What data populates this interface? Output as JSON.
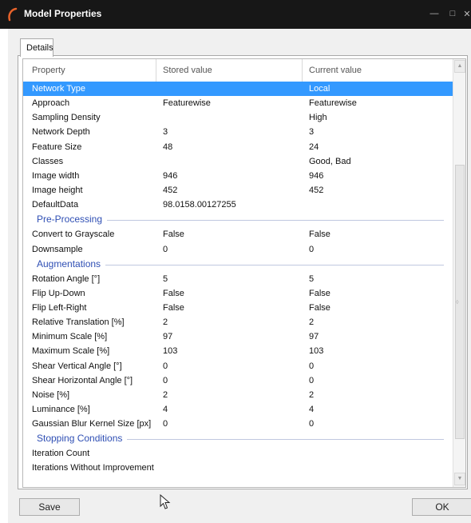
{
  "window": {
    "title": "Model Properties",
    "logo_icon": "app-logo-icon",
    "accent": "#e8632b",
    "title_bar_color": "#171717"
  },
  "tabs": [
    {
      "label": "Details"
    }
  ],
  "grid": {
    "columns": [
      "Property",
      "Stored value",
      "Current value"
    ],
    "selected_color": "#3399ff",
    "top_rows": [
      {
        "name": "Network Type",
        "stored": "",
        "current": "Local",
        "selected": true
      },
      {
        "name": "Approach",
        "stored": "Featurewise",
        "current": "Featurewise"
      },
      {
        "name": "Sampling Density",
        "stored": "",
        "current": "High"
      },
      {
        "name": "Network Depth",
        "stored": "3",
        "current": "3"
      },
      {
        "name": "Feature Size",
        "stored": "48",
        "current": "24"
      },
      {
        "name": "Classes",
        "stored": "",
        "current": "Good, Bad"
      },
      {
        "name": "Image width",
        "stored": "946",
        "current": "946"
      },
      {
        "name": "Image height",
        "stored": "452",
        "current": "452"
      },
      {
        "name": "DefaultData",
        "stored": "98.0158.00127255",
        "current": ""
      }
    ],
    "categories": [
      {
        "title": "Pre-Processing",
        "rows": [
          {
            "name": "Convert to Grayscale",
            "stored": "False",
            "current": "False"
          },
          {
            "name": "Downsample",
            "stored": "0",
            "current": "0"
          }
        ]
      },
      {
        "title": "Augmentations",
        "rows": [
          {
            "name": "Rotation Angle [°]",
            "stored": "5",
            "current": "5"
          },
          {
            "name": "Flip Up-Down",
            "stored": "False",
            "current": "False"
          },
          {
            "name": "Flip Left-Right",
            "stored": "False",
            "current": "False"
          },
          {
            "name": "Relative Translation [%]",
            "stored": "2",
            "current": "2"
          },
          {
            "name": "Minimum Scale [%]",
            "stored": "97",
            "current": "97"
          },
          {
            "name": "Maximum Scale [%]",
            "stored": "103",
            "current": "103"
          },
          {
            "name": "Shear Vertical Angle [°]",
            "stored": "0",
            "current": "0"
          },
          {
            "name": "Shear Horizontal Angle [°]",
            "stored": "0",
            "current": "0"
          },
          {
            "name": "Noise [%]",
            "stored": "2",
            "current": "2"
          },
          {
            "name": "Luminance [%]",
            "stored": "4",
            "current": "4"
          },
          {
            "name": "Gaussian Blur Kernel Size [px]",
            "stored": "0",
            "current": "0"
          }
        ]
      },
      {
        "title": "Stopping Conditions",
        "rows": [
          {
            "name": "Iteration Count",
            "stored": "",
            "current": ""
          },
          {
            "name": "Iterations Without Improvement",
            "stored": "",
            "current": ""
          }
        ]
      }
    ]
  },
  "buttons": {
    "save": "Save",
    "ok": "OK"
  }
}
